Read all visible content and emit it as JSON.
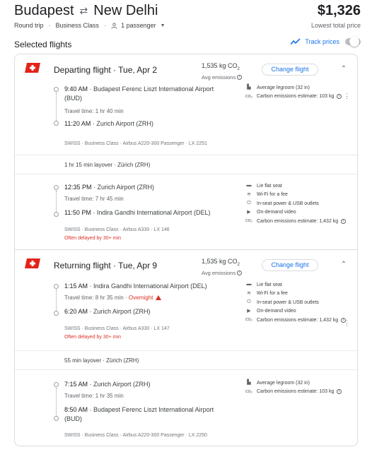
{
  "header": {
    "origin": "Budapest",
    "destination": "New Delhi",
    "price": "$1,326",
    "price_note": "Lowest total price",
    "trip_type": "Round trip",
    "cabin": "Business Class",
    "passengers": "1 passenger"
  },
  "section_title": "Selected flights",
  "track_prices": {
    "label": "Track prices",
    "enabled": false
  },
  "departing": {
    "title": "Departing flight · Tue, Apr 2",
    "emissions": "1,535 kg CO",
    "emissions_sub": "2",
    "emissions_note": "Avg emissions",
    "change_label": "Change flight",
    "seg1": {
      "dep_time": "9:40 AM",
      "dep_airport": "Budapest Ferenc Liszt International Airport (BUD)",
      "travel": "Travel time: 1 hr 40 min",
      "arr_time": "11:20 AM",
      "arr_airport": "Zurich Airport (ZRH)",
      "details": "SWISS · Business Class · Airbus A220-300 Passenger · LX 2251",
      "amenities": [
        "Average legroom (32 in)",
        "Carbon emissions estimate: 103 kg"
      ]
    },
    "layover": "1 hr 15 min layover · Zürich (ZRH)",
    "seg2": {
      "dep_time": "12:35 PM",
      "dep_airport": "Zurich Airport (ZRH)",
      "travel": "Travel time: 7 hr 45 min",
      "arr_time": "11:50 PM",
      "arr_airport": "Indira Gandhi International Airport (DEL)",
      "details": "SWISS · Business Class · Airbus A330 · LX 146",
      "delayed": "Often delayed by 30+ min",
      "amenities": [
        "Lie flat seat",
        "Wi-Fi for a fee",
        "In-seat power & USB outlets",
        "On-demand video",
        "Carbon emissions estimate: 1,432 kg"
      ]
    }
  },
  "returning": {
    "title": "Returning flight · Tue, Apr 9",
    "emissions": "1,535 kg CO",
    "emissions_sub": "2",
    "emissions_note": "Avg emissions",
    "change_label": "Change flight",
    "seg1": {
      "dep_time": "1:15 AM",
      "dep_airport": "Indira Gandhi International Airport (DEL)",
      "travel": "Travel time: 8 hr 35 min · ",
      "overnight": "Overnight",
      "arr_time": "6:20 AM",
      "arr_airport": "Zurich Airport (ZRH)",
      "details": "SWISS · Business Class · Airbus A330 · LX 147",
      "delayed": "Often delayed by 30+ min",
      "amenities": [
        "Lie flat seat",
        "Wi-Fi for a fee",
        "In-seat power & USB outlets",
        "On-demand video",
        "Carbon emissions estimate: 1,432 kg"
      ]
    },
    "layover": "55 min layover · Zürich (ZRH)",
    "seg2": {
      "dep_time": "7:15 AM",
      "dep_airport": "Zurich Airport (ZRH)",
      "travel": "Travel time: 1 hr 35 min",
      "arr_time": "8:50 AM",
      "arr_airport": "Budapest Ferenc Liszt International Airport (BUD)",
      "details": "SWISS · Business Class · Airbus A220-300 Passenger · LX 2250",
      "amenities": [
        "Average legroom (32 in)",
        "Carbon emissions estimate: 103 kg"
      ]
    }
  },
  "colors": {
    "accent": "#1a73e8",
    "warning": "#d93025",
    "swiss_red": "#e2231a"
  }
}
